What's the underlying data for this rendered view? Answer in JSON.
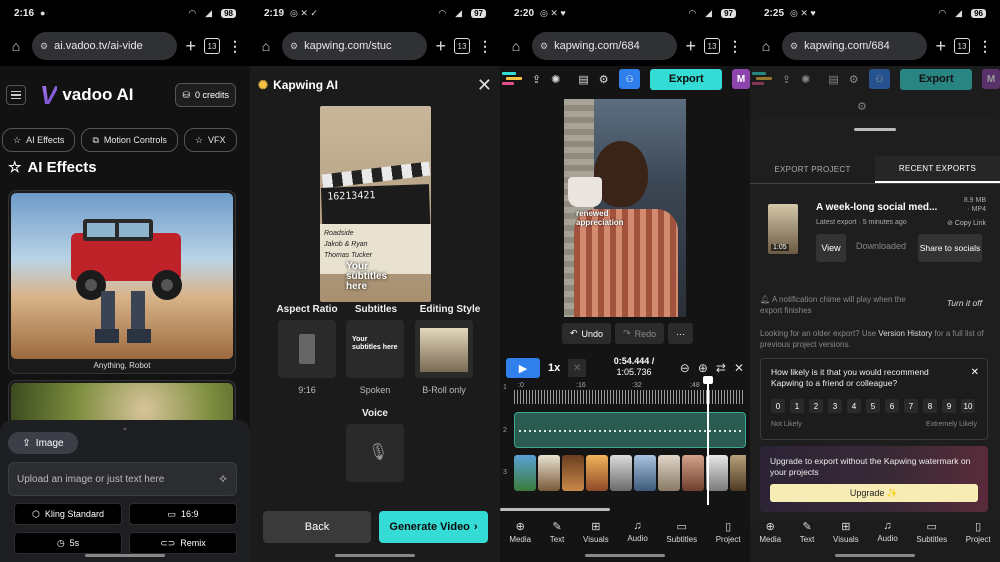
{
  "panels": {
    "p1": {
      "status": {
        "time": "2:16",
        "battery": "98"
      },
      "url": "ai.vadoo.tv/ai-vide",
      "tab_count": "13",
      "brand": {
        "mark": "V",
        "name": "vadoo AI"
      },
      "credits": "0 credits",
      "chips": [
        "AI Effects",
        "Motion Controls",
        "VFX"
      ],
      "section_title": "AI Effects",
      "card1_caption": "Anything, Robot",
      "image_button": "Image",
      "upload_placeholder": "Upload an image or just text here",
      "options": {
        "model": "Kling Standard",
        "ratio": "16:9",
        "duration": "5s",
        "remix": "Remix"
      }
    },
    "p2": {
      "status": {
        "time": "2:19",
        "battery": "97"
      },
      "url": "kapwing.com/stuc",
      "tab_count": "13",
      "title": "Kapwing AI",
      "preview_slate_number": "16213421",
      "preview_lines": [
        "Roadside",
        "Jakob & Ryan",
        "Thomas Tucker"
      ],
      "preview_overlay": "Your subtitles here",
      "options": [
        {
          "label": "Aspect Ratio",
          "sub": "9:16"
        },
        {
          "label": "Subtitles",
          "sub": "Spoken",
          "box_text": "Your subtitles here"
        },
        {
          "label": "Editing Style",
          "sub": "B-Roll only"
        }
      ],
      "voice_label": "Voice",
      "back": "Back",
      "generate": "Generate Video"
    },
    "p3": {
      "status": {
        "time": "2:20",
        "battery": "97"
      },
      "url": "kapwing.com/684",
      "tab_count": "13",
      "export": "Export",
      "avatar": "M",
      "overlay": "renewed appreciation",
      "undo": "Undo",
      "redo": "Redo",
      "more": "···",
      "speed": "1x",
      "time_current": "0:54.444 /",
      "time_total": "1:05.736",
      "ruler": [
        ":0",
        ":16",
        ":32",
        ":48"
      ],
      "track_numbers": [
        "1",
        "2",
        "3"
      ],
      "nav": [
        "Media",
        "Text",
        "Visuals",
        "Audio",
        "Subtitles",
        "Project"
      ]
    },
    "p4": {
      "status": {
        "time": "2:25",
        "battery": "96"
      },
      "url": "kapwing.com/684",
      "tab_count": "13",
      "export": "Export",
      "avatar": "M",
      "tabs": [
        "EXPORT PROJECT",
        "RECENT EXPORTS"
      ],
      "item": {
        "title": "A week-long social med...",
        "size": "8.9 MB",
        "format": "· MP4",
        "latest": "Latest export · 5 minutes ago",
        "copy": "Copy Link",
        "duration": "1:05",
        "view": "View",
        "downloaded": "Downloaded",
        "share": "Share to socials"
      },
      "notification": "A notification chime will play when the export finishes",
      "turn_off": "Turn it off",
      "older_a": "Looking for an older export? Use ",
      "older_link": "Version History",
      "older_b": " for a full list of previous project versions.",
      "survey_q": "How likely is it that you would recommend Kapwing to a friend or colleague?",
      "survey_scale": [
        "0",
        "1",
        "2",
        "3",
        "4",
        "5",
        "6",
        "7",
        "8",
        "9",
        "10"
      ],
      "not_likely": "Not Likely",
      "extremely_likely": "Extremely Likely",
      "upgrade_text": "Upgrade to export without the Kapwing watermark on your projects",
      "upgrade_btn": "Upgrade ✨",
      "nav": [
        "Media",
        "Text",
        "Visuals",
        "Audio",
        "Subtitles",
        "Project"
      ]
    }
  }
}
